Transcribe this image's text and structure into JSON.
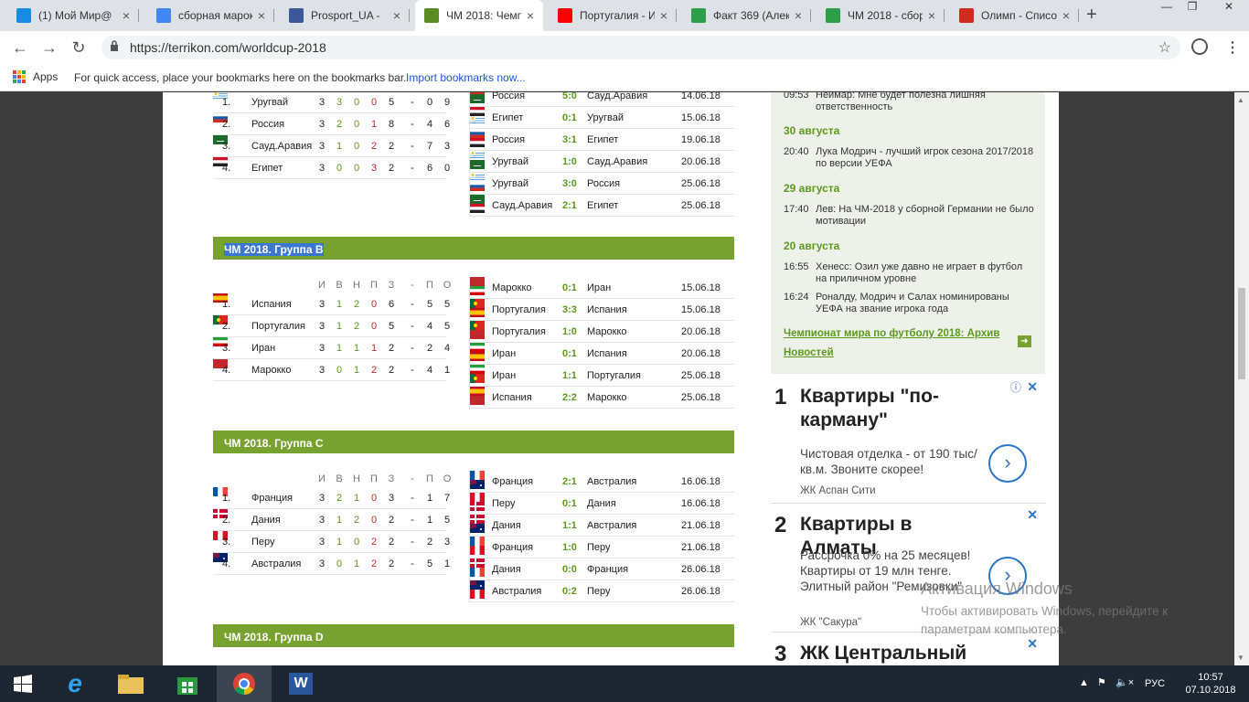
{
  "browser": {
    "tabs": [
      {
        "title": "(1) Мой Мир@",
        "icon": "mymir-icon",
        "color": "#168de2"
      },
      {
        "title": "сборная марок",
        "icon": "google-icon",
        "color": "#4285f4"
      },
      {
        "title": "Prosport_UA - ",
        "icon": "facebook-icon",
        "color": "#3b5998"
      },
      {
        "title": "ЧМ 2018: Чемп",
        "icon": "terrikon-icon",
        "color": "#5a8a22"
      },
      {
        "title": "Португалия - И",
        "icon": "youtube-icon",
        "color": "#ff0000"
      },
      {
        "title": "Факт 369 (Алек",
        "icon": "sheet-icon",
        "color": "#2e9e4a"
      },
      {
        "title": "ЧМ 2018 - сбор",
        "icon": "sheet-icon",
        "color": "#2e9e4a"
      },
      {
        "title": "Олимп - Списо",
        "icon": "olimp-icon",
        "color": "#d12b1f"
      }
    ],
    "url": "https://terrikon.com/worldcup-2018",
    "bookmarks": {
      "apps": "Apps",
      "hint": "For quick access, place your bookmarks here on the bookmarks bar.",
      "import": "Import bookmarks now..."
    }
  },
  "columns": [
    "И",
    "В",
    "Н",
    "П",
    "З",
    "-",
    "П",
    "О"
  ],
  "groups": [
    {
      "title": "",
      "standings": [
        {
          "pos": "1.",
          "team": "Уругвай",
          "flag": "URY",
          "p": "3",
          "w": "3",
          "d": "0",
          "l": "0",
          "gf": "5",
          "sep": "-",
          "ga": "0",
          "pts": "9"
        },
        {
          "pos": "2.",
          "team": "Россия",
          "flag": "RUS",
          "p": "3",
          "w": "2",
          "d": "0",
          "l": "1",
          "gf": "8",
          "sep": "-",
          "ga": "4",
          "pts": "6"
        },
        {
          "pos": "3.",
          "team": "Сауд.Аравия",
          "flag": "KSA",
          "p": "3",
          "w": "1",
          "d": "0",
          "l": "2",
          "gf": "2",
          "sep": "-",
          "ga": "7",
          "pts": "3"
        },
        {
          "pos": "4.",
          "team": "Египет",
          "flag": "EGY",
          "p": "3",
          "w": "0",
          "d": "0",
          "l": "3",
          "gf": "2",
          "sep": "-",
          "ga": "6",
          "pts": "0"
        }
      ],
      "matches": [
        {
          "home": "Россия",
          "hf": "RUS",
          "score": "5:0",
          "away": "Сауд.Аравия",
          "af": "KSA",
          "date": "14.06.18"
        },
        {
          "home": "Египет",
          "hf": "EGY",
          "score": "0:1",
          "away": "Уругвай",
          "af": "URY",
          "date": "15.06.18"
        },
        {
          "home": "Россия",
          "hf": "RUS",
          "score": "3:1",
          "away": "Египет",
          "af": "EGY",
          "date": "19.06.18"
        },
        {
          "home": "Уругвай",
          "hf": "URY",
          "score": "1:0",
          "away": "Сауд.Аравия",
          "af": "KSA",
          "date": "20.06.18"
        },
        {
          "home": "Уругвай",
          "hf": "URY",
          "score": "3:0",
          "away": "Россия",
          "af": "RUS",
          "date": "25.06.18"
        },
        {
          "home": "Сауд.Аравия",
          "hf": "KSA",
          "score": "2:1",
          "away": "Египет",
          "af": "EGY",
          "date": "25.06.18"
        }
      ]
    },
    {
      "title": "ЧМ 2018. Группа B",
      "standings": [
        {
          "pos": "1.",
          "team": "Испания",
          "flag": "ESP",
          "p": "3",
          "w": "1",
          "d": "2",
          "l": "0",
          "gf": "6",
          "sep": "-",
          "ga": "5",
          "pts": "5"
        },
        {
          "pos": "2.",
          "team": "Португалия",
          "flag": "POR",
          "p": "3",
          "w": "1",
          "d": "2",
          "l": "0",
          "gf": "5",
          "sep": "-",
          "ga": "4",
          "pts": "5"
        },
        {
          "pos": "3.",
          "team": "Иран",
          "flag": "IRN",
          "p": "3",
          "w": "1",
          "d": "1",
          "l": "1",
          "gf": "2",
          "sep": "-",
          "ga": "2",
          "pts": "4"
        },
        {
          "pos": "4.",
          "team": "Марокко",
          "flag": "MAR",
          "p": "3",
          "w": "0",
          "d": "1",
          "l": "2",
          "gf": "2",
          "sep": "-",
          "ga": "4",
          "pts": "1"
        }
      ],
      "matches": [
        {
          "home": "Марокко",
          "hf": "MAR",
          "score": "0:1",
          "away": "Иран",
          "af": "IRN",
          "date": "15.06.18"
        },
        {
          "home": "Португалия",
          "hf": "POR",
          "score": "3:3",
          "away": "Испания",
          "af": "ESP",
          "date": "15.06.18"
        },
        {
          "home": "Португалия",
          "hf": "POR",
          "score": "1:0",
          "away": "Марокко",
          "af": "MAR",
          "date": "20.06.18"
        },
        {
          "home": "Иран",
          "hf": "IRN",
          "score": "0:1",
          "away": "Испания",
          "af": "ESP",
          "date": "20.06.18"
        },
        {
          "home": "Иран",
          "hf": "IRN",
          "score": "1:1",
          "away": "Португалия",
          "af": "POR",
          "date": "25.06.18"
        },
        {
          "home": "Испания",
          "hf": "ESP",
          "score": "2:2",
          "away": "Марокко",
          "af": "MAR",
          "date": "25.06.18"
        }
      ]
    },
    {
      "title": "ЧМ 2018. Группа C",
      "standings": [
        {
          "pos": "1.",
          "team": "Франция",
          "flag": "FRA",
          "p": "3",
          "w": "2",
          "d": "1",
          "l": "0",
          "gf": "3",
          "sep": "-",
          "ga": "1",
          "pts": "7"
        },
        {
          "pos": "2.",
          "team": "Дания",
          "flag": "DEN",
          "p": "3",
          "w": "1",
          "d": "2",
          "l": "0",
          "gf": "2",
          "sep": "-",
          "ga": "1",
          "pts": "5"
        },
        {
          "pos": "3.",
          "team": "Перу",
          "flag": "PER",
          "p": "3",
          "w": "1",
          "d": "0",
          "l": "2",
          "gf": "2",
          "sep": "-",
          "ga": "2",
          "pts": "3"
        },
        {
          "pos": "4.",
          "team": "Австралия",
          "flag": "AUS",
          "p": "3",
          "w": "0",
          "d": "1",
          "l": "2",
          "gf": "2",
          "sep": "-",
          "ga": "5",
          "pts": "1"
        }
      ],
      "matches": [
        {
          "home": "Франция",
          "hf": "FRA",
          "score": "2:1",
          "away": "Австралия",
          "af": "AUS",
          "date": "16.06.18"
        },
        {
          "home": "Перу",
          "hf": "PER",
          "score": "0:1",
          "away": "Дания",
          "af": "DEN",
          "date": "16.06.18"
        },
        {
          "home": "Дания",
          "hf": "DEN",
          "score": "1:1",
          "away": "Австралия",
          "af": "AUS",
          "date": "21.06.18"
        },
        {
          "home": "Франция",
          "hf": "FRA",
          "score": "1:0",
          "away": "Перу",
          "af": "PER",
          "date": "21.06.18"
        },
        {
          "home": "Дания",
          "hf": "DEN",
          "score": "0:0",
          "away": "Франция",
          "af": "FRA",
          "date": "26.06.18"
        },
        {
          "home": "Австралия",
          "hf": "AUS",
          "score": "0:2",
          "away": "Перу",
          "af": "PER",
          "date": "26.06.18"
        }
      ]
    },
    {
      "title": "ЧМ 2018. Группа D",
      "standings": [],
      "matches": []
    }
  ],
  "sidebar": {
    "news": [
      {
        "time": "09:53",
        "text": "Неймар: Мне будет полезна лишняя ответственность"
      },
      {
        "date": "30 августа"
      },
      {
        "time": "20:40",
        "text": "Лука Модрич - лучший игрок сезона 2017/2018 по версии УЕФА"
      },
      {
        "date": "29 августа"
      },
      {
        "time": "17:40",
        "text": "Лев: На ЧМ-2018 у сборной Германии не было мотивации"
      },
      {
        "date": "20 августа"
      },
      {
        "time": "16:55",
        "text": "Хенесс: Озил уже давно не играет в футбол на приличном уровне"
      },
      {
        "time": "16:24",
        "text": "Роналду, Модрич и Салах номинированы УЕФА на звание игрока года"
      }
    ],
    "archive": "Чемпионат мира по футболу 2018: Архив Новостей"
  },
  "ads": [
    {
      "num": "1",
      "title": "Квартиры \"по-карману\"",
      "body": "Чистовая отделка - от 190 тыс/кв.м. Звоните скорее!",
      "src": "ЖК Аспан Сити"
    },
    {
      "num": "2",
      "title": "Квартиры в Алматы",
      "body": "Рассрочка 0% на 25 месяцев! Квартиры от 19 млн тенге. Элитный район \"Ремизовки\"",
      "src": "ЖК \"Сакура\""
    },
    {
      "num": "3",
      "title": "ЖК Центральный в",
      "body": "",
      "src": ""
    }
  ],
  "watermark": {
    "title": "Активация Windows",
    "text": "Чтобы активировать Windows, перейдите к параметрам компьютера."
  },
  "taskbar": {
    "lang": "РУС",
    "time": "10:57",
    "date": "07.10.2018"
  }
}
